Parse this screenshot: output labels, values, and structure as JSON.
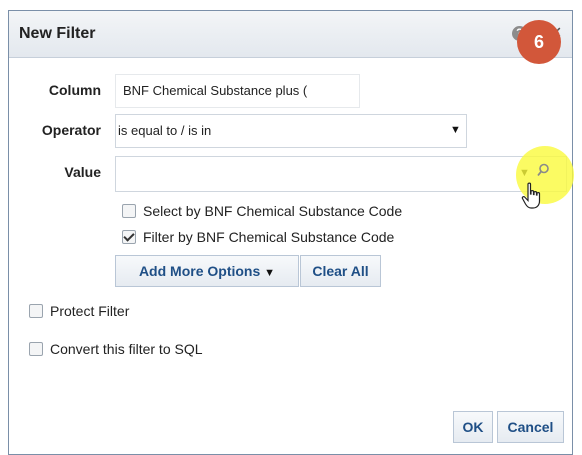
{
  "dialog": {
    "title": "New Filter",
    "help_glyph": "?",
    "close_glyph": "✕",
    "step_badge": "6"
  },
  "form": {
    "column": {
      "label": "Column",
      "value": "BNF Chemical Substance plus ("
    },
    "operator": {
      "label": "Operator",
      "value": "is equal to / is in"
    },
    "value": {
      "label": "Value",
      "value": ""
    }
  },
  "options": {
    "select_by_code": {
      "label": "Select by BNF Chemical Substance Code",
      "checked": false
    },
    "filter_by_code": {
      "label": "Filter by BNF Chemical Substance Code",
      "checked": true
    }
  },
  "buttons": {
    "add_more_options": "Add More Options",
    "add_more_caret": "▼",
    "clear_all": "Clear All",
    "ok": "OK",
    "cancel": "Cancel"
  },
  "checkboxes": {
    "protect_filter": {
      "label": "Protect Filter",
      "checked": false
    },
    "convert_sql": {
      "label": "Convert this filter to SQL",
      "checked": false
    }
  },
  "icons": {
    "dropdown_caret": "▼",
    "search": "search-icon",
    "cursor": "hand-pointer-icon"
  },
  "colors": {
    "badge": "#d2573a",
    "button_text": "#1f4f86",
    "highlight": "#fafa3c"
  }
}
